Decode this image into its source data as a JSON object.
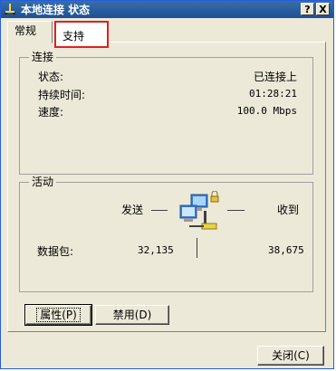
{
  "window": {
    "title": "本地连接 状态",
    "help_label": "?",
    "close_label": "X"
  },
  "tabs": [
    {
      "label": "常规",
      "active": true
    },
    {
      "label": "支持",
      "active": false,
      "highlighted": true
    }
  ],
  "connection": {
    "group_label": "连接",
    "rows": [
      {
        "label": "状态:",
        "value": "已连接上"
      },
      {
        "label": "持续时间:",
        "value": "01:28:21"
      },
      {
        "label": "速度:",
        "value": "100.0 Mbps"
      }
    ]
  },
  "activity": {
    "group_label": "活动",
    "sent_label": "发送",
    "received_label": "收到",
    "packets_label": "数据包:",
    "packets_sent": "32,135",
    "packets_received": "38,675"
  },
  "buttons": {
    "properties": "属性(P)",
    "disable": "禁用(D)",
    "close": "关闭(C)"
  },
  "colors": {
    "titlebar": "#1e4f96",
    "face": "#ece9d8",
    "highlight_box": "#e02020"
  },
  "icons": {
    "title": "network-connection-icon",
    "activity": "network-computers-icon"
  }
}
